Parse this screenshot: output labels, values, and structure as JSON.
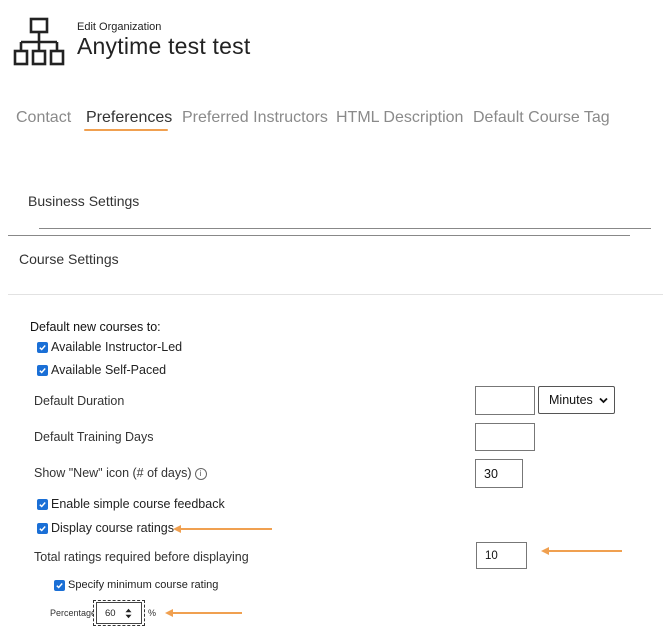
{
  "header": {
    "subtitle": "Edit Organization",
    "title": "Anytime test test"
  },
  "tabs": [
    {
      "label": "Contact",
      "active": false
    },
    {
      "label": "Preferences",
      "active": true
    },
    {
      "label": "Preferred Instructors",
      "active": false
    },
    {
      "label": "HTML Description",
      "active": false
    },
    {
      "label": "Default Course Tag",
      "active": false
    }
  ],
  "sections": {
    "business": "Business Settings",
    "course": "Course Settings"
  },
  "course_settings": {
    "default_new_courses_label": "Default new courses to:",
    "available_instructor_led": {
      "label": "Available Instructor-Led",
      "checked": true
    },
    "available_self_paced": {
      "label": "Available Self-Paced",
      "checked": true
    },
    "default_duration": {
      "label": "Default Duration",
      "value": "",
      "unit": "Minutes"
    },
    "default_training_days": {
      "label": "Default Training Days",
      "value": ""
    },
    "show_new_icon": {
      "label": "Show \"New\" icon (# of days)",
      "value": "30"
    },
    "enable_simple_feedback": {
      "label": "Enable simple course feedback",
      "checked": true
    },
    "display_course_ratings": {
      "label": "Display course ratings",
      "checked": true
    },
    "total_ratings_required": {
      "label": "Total ratings required before displaying",
      "value": "10"
    },
    "specify_min_rating": {
      "label": "Specify minimum course rating",
      "checked": true
    },
    "percentage": {
      "label": "Percentage",
      "value": "60",
      "unit": "%"
    }
  },
  "colors": {
    "accent": "#f0a050",
    "checkbox": "#1a6fd6"
  }
}
